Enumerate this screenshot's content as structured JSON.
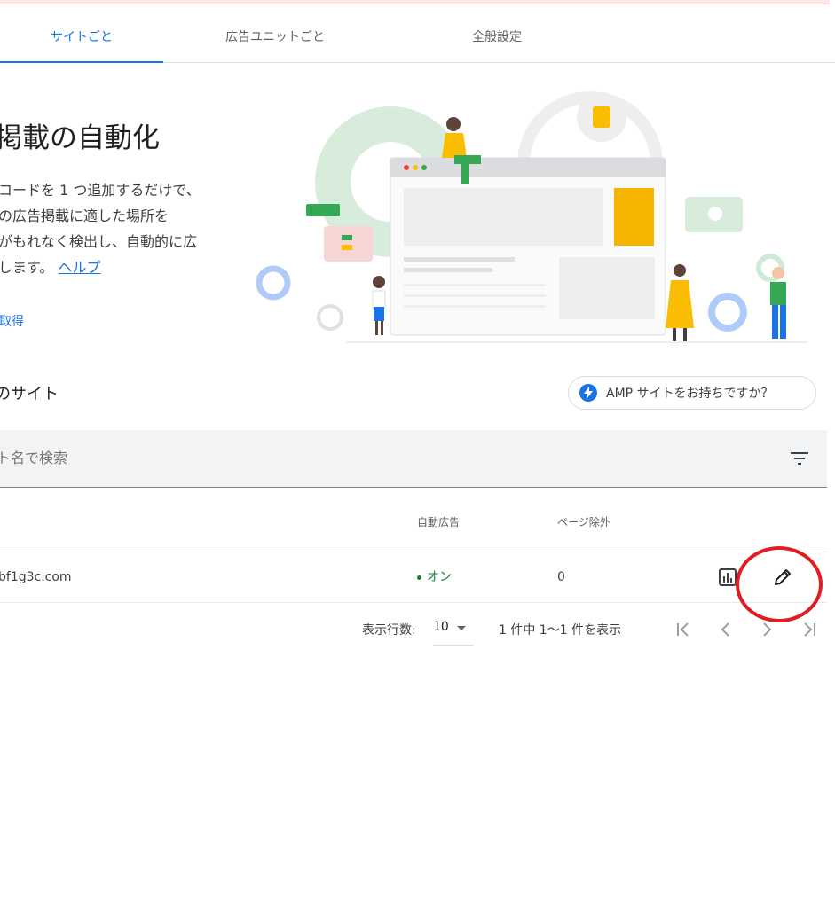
{
  "tabs": [
    {
      "label": "サイトごと",
      "active": true
    },
    {
      "label": "広告ユニットごと",
      "active": false
    },
    {
      "label": "全般設定",
      "active": false
    }
  ],
  "hero": {
    "title": "掲載の自動化",
    "description_lines": [
      "コードを 1 つ追加するだけで、",
      "の広告掲載に適した場所を",
      "がもれなく検出し、自動的に広",
      "します。"
    ],
    "help_link": "ヘルプ",
    "get_code_link": "取得"
  },
  "sites_section": {
    "title": "のサイト",
    "amp_button": "AMP サイトをお持ちですか？"
  },
  "search": {
    "placeholder": "ト名で検索"
  },
  "table": {
    "headers": [
      "自動広告",
      "ページ除外"
    ],
    "rows": [
      {
        "site": "bf1g3c.com",
        "auto_ads": "オン",
        "page_exclusions": "0"
      }
    ]
  },
  "pagination": {
    "rows_label": "表示行数:",
    "rows_value": "10",
    "range_text": "1 件中 1〜1 件を表示"
  },
  "colors": {
    "accent": "#1a73e8",
    "on_status": "#188038",
    "highlight_circle": "#e11d24"
  }
}
